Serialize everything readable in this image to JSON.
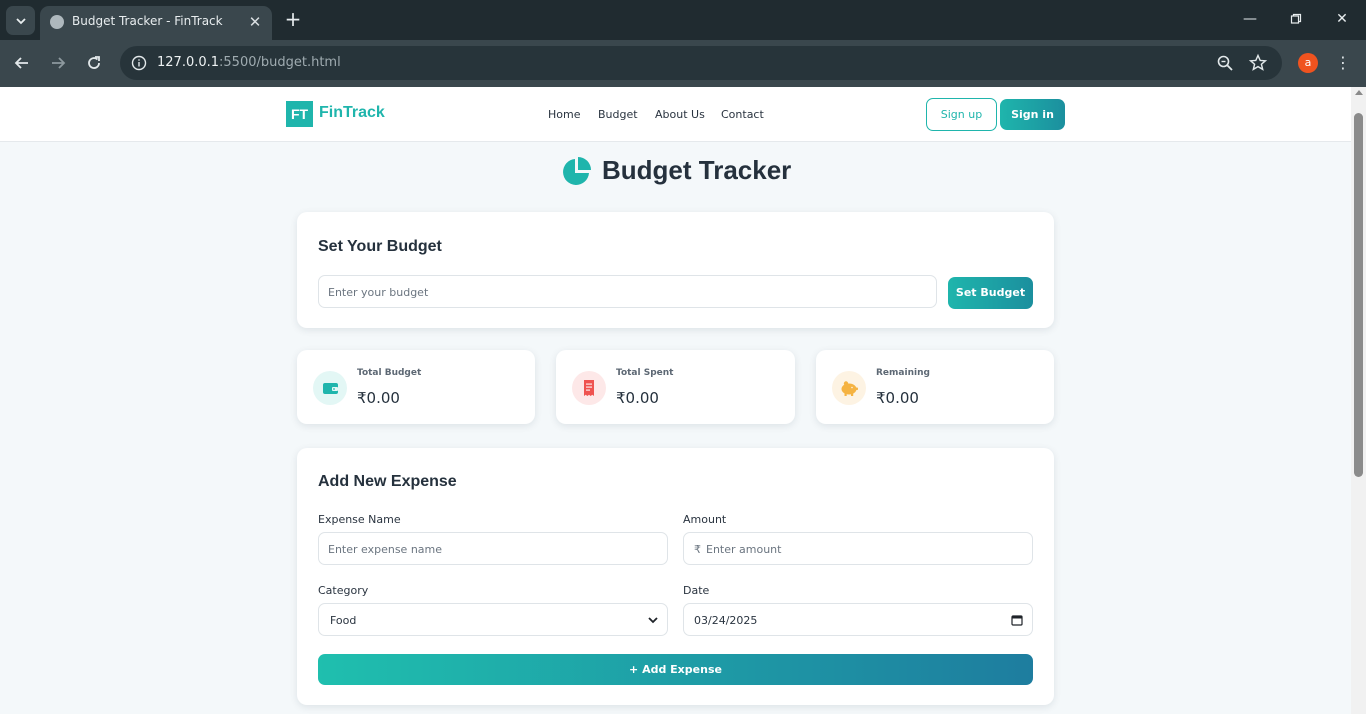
{
  "browser": {
    "tab_title": "Budget Tracker - FinTrack",
    "url_host": "127.0.0.1",
    "url_rest": ":5500/budget.html",
    "profile_initial": "a"
  },
  "header": {
    "logo_mark": "FT",
    "logo_text": "FinTrack",
    "nav": [
      "Home",
      "Budget",
      "About Us",
      "Contact"
    ],
    "signup_label": "Sign up",
    "signin_label": "Sign in"
  },
  "page": {
    "title": "Budget Tracker"
  },
  "budget_card": {
    "heading": "Set Your Budget",
    "input_placeholder": "Enter your budget",
    "button_label": "Set Budget"
  },
  "stats": [
    {
      "label": "Total Budget",
      "value": "₹0.00",
      "icon": "wallet-icon",
      "color": "#1fb5ac"
    },
    {
      "label": "Total Spent",
      "value": "₹0.00",
      "icon": "receipt-icon",
      "color": "#ef5350"
    },
    {
      "label": "Remaining",
      "value": "₹0.00",
      "icon": "piggy-bank-icon",
      "color": "#f5b342"
    }
  ],
  "expense_card": {
    "heading": "Add New Expense",
    "name_label": "Expense Name",
    "name_placeholder": "Enter expense name",
    "amount_label": "Amount",
    "currency_symbol": "₹",
    "amount_placeholder": "Enter amount",
    "category_label": "Category",
    "category_value": "Food",
    "date_label": "Date",
    "date_value": "03/24/2025",
    "add_button": "+ Add Expense"
  },
  "colors": {
    "accent": "#1fb5ac",
    "accent_dark": "#1e7d9f",
    "text_dark": "#25313d"
  }
}
